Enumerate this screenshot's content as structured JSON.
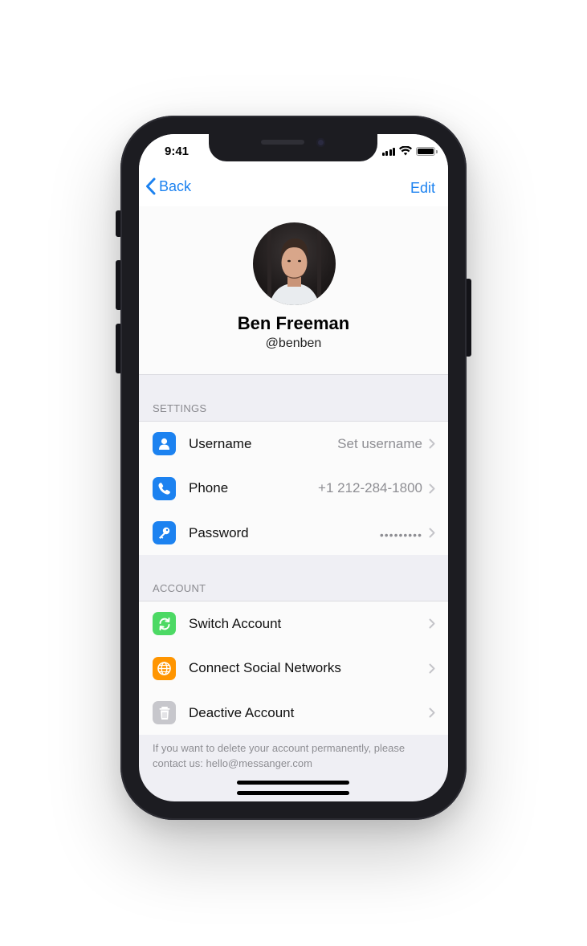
{
  "status_bar": {
    "time": "9:41"
  },
  "nav": {
    "back_label": "Back",
    "edit_label": "Edit"
  },
  "profile": {
    "name": "Ben Freeman",
    "handle": "@benben"
  },
  "settings": {
    "header": "SETTINGS",
    "items": [
      {
        "label": "Username",
        "value": "Set username",
        "icon": "person-icon",
        "color": "#1c82f0"
      },
      {
        "label": "Phone",
        "value": "+1 212-284-1800",
        "icon": "phone-icon",
        "color": "#1c82f0"
      },
      {
        "label": "Password",
        "value": "•••••••••",
        "icon": "key-icon",
        "color": "#1c82f0"
      }
    ]
  },
  "account": {
    "header": "ACCOUNT",
    "items": [
      {
        "label": "Switch Account",
        "icon": "switch-icon",
        "color": "#4cd964"
      },
      {
        "label": "Connect Social Networks",
        "icon": "globe-icon",
        "color": "#ff9500"
      },
      {
        "label": "Deactive Account",
        "icon": "trash-icon",
        "color": "#c7c7cc"
      }
    ],
    "footnote": "If you want to delete your account permanently, please contact us: hello@messanger.com"
  },
  "colors": {
    "accent": "#1c82f0",
    "background": "#efeff4"
  }
}
